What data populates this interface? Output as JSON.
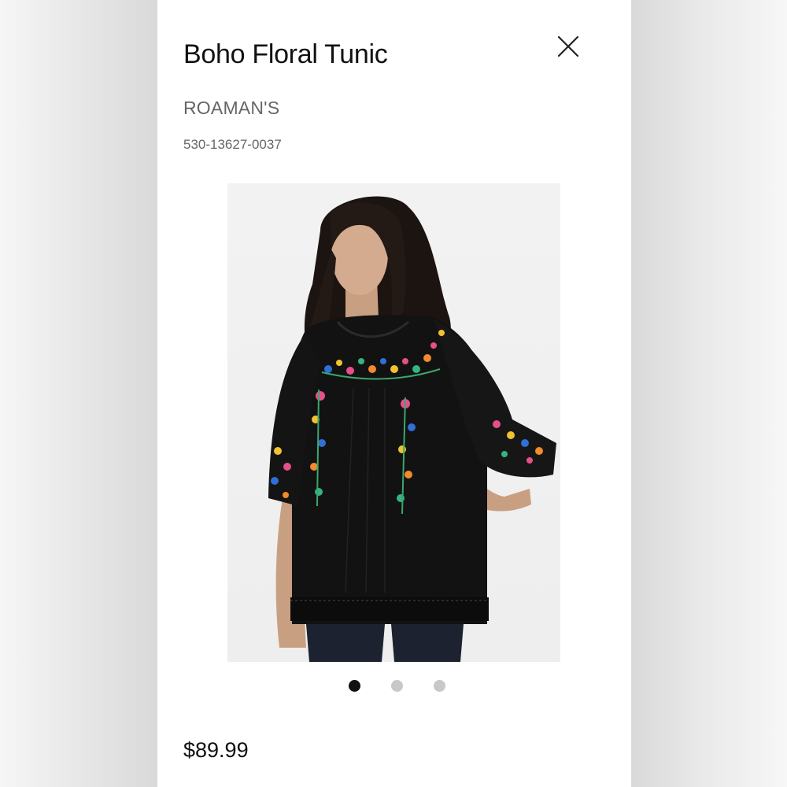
{
  "product": {
    "title": "Boho Floral Tunic",
    "brand": "ROAMAN'S",
    "sku": "530-13627-0037",
    "price": "$89.99"
  },
  "controls": {
    "close_icon": "close-icon"
  },
  "gallery": {
    "image_subject": "model wearing black tunic with colorful floral embroidery",
    "image_count": 3,
    "active_index": 0
  },
  "colors": {
    "dot_active": "#111111",
    "dot_inactive": "#c8c8c8"
  }
}
